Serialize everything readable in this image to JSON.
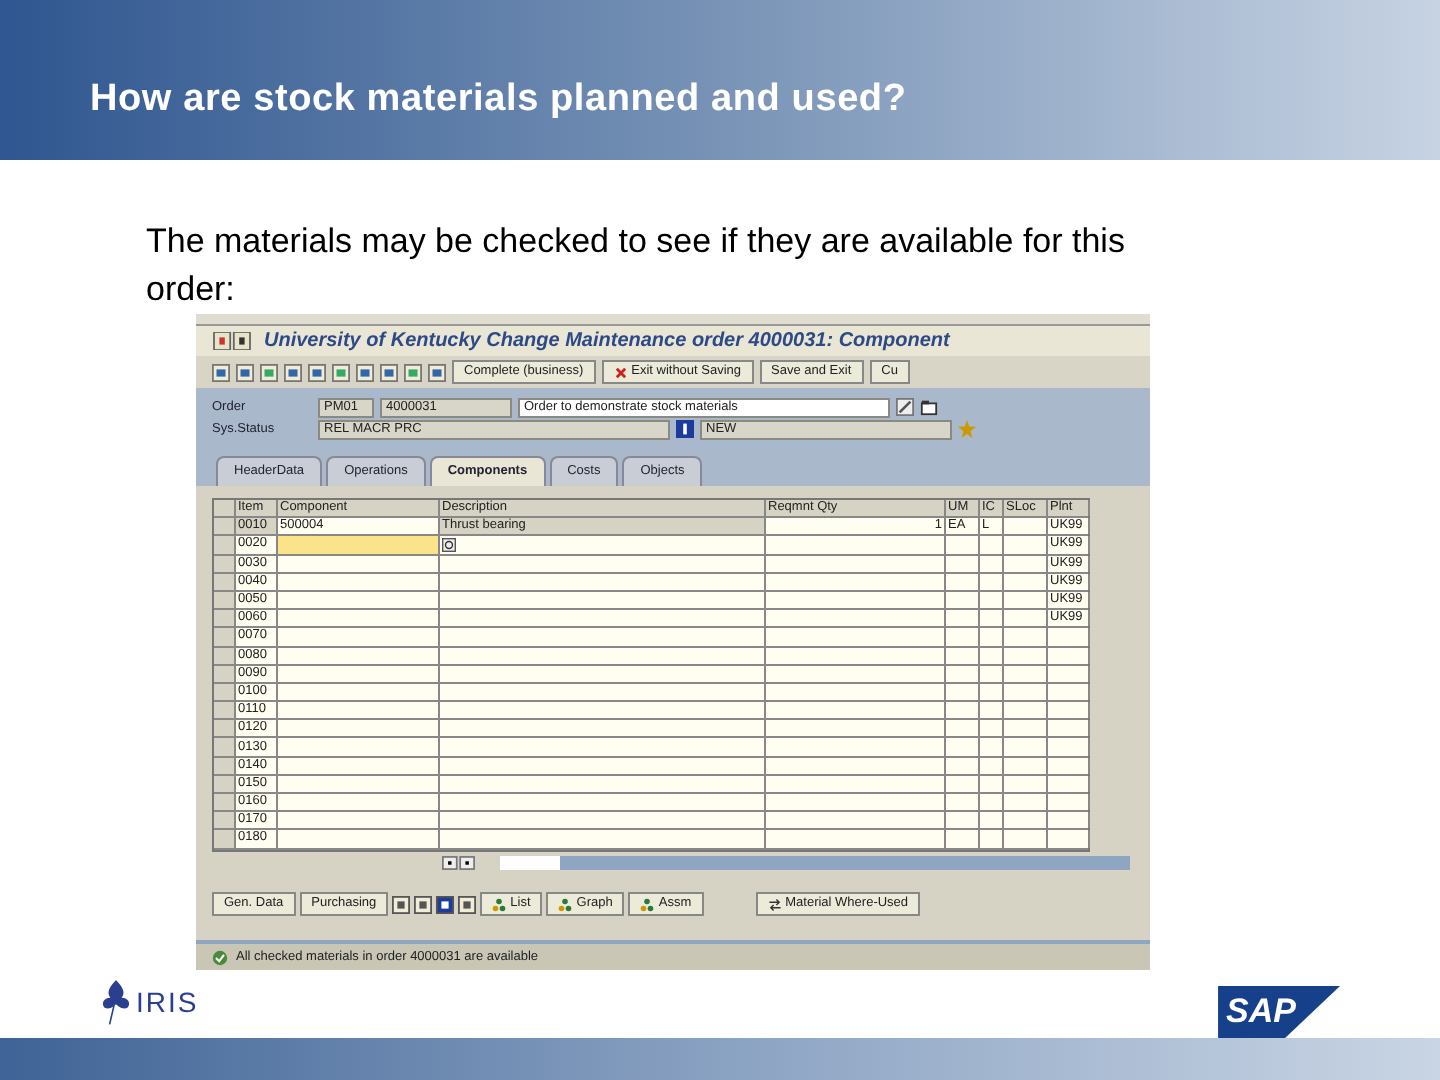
{
  "slide": {
    "title": "How are stock materials planned and used?",
    "body": "The materials may be checked to see if they are available for this order:"
  },
  "sap": {
    "window_title": "University of Kentucky Change Maintenance order 4000031: Component",
    "toolbar_buttons": [
      {
        "label": "Complete (business)",
        "kind": "plain"
      },
      {
        "label": "Exit without Saving",
        "kind": "exit"
      },
      {
        "label": "Save and Exit",
        "kind": "plain"
      },
      {
        "label": "Cu",
        "kind": "plain"
      }
    ],
    "order": {
      "label": "Order",
      "type": "PM01",
      "number": "4000031",
      "description": "Order to demonstrate stock materials"
    },
    "status": {
      "label": "Sys.Status",
      "value": "REL  MACR  PRC",
      "user_status": "NEW"
    },
    "tabs": [
      {
        "label": "HeaderData",
        "selected": false
      },
      {
        "label": "Operations",
        "selected": false
      },
      {
        "label": "Components",
        "selected": true
      },
      {
        "label": "Costs",
        "selected": false
      },
      {
        "label": "Objects",
        "selected": false
      }
    ],
    "columns": [
      "Item",
      "Component",
      "Description",
      "Reqmnt Qty",
      "UM",
      "IC",
      "SLoc",
      "Plnt"
    ],
    "rows": [
      {
        "item": "0010",
        "component": "500004",
        "description": "Thrust bearing",
        "qty": "1",
        "um": "EA",
        "ic": "L",
        "sloc": "",
        "plant": "UK99",
        "focused": false
      },
      {
        "item": "0020",
        "component": "",
        "description": "",
        "qty": "",
        "um": "",
        "ic": "",
        "sloc": "",
        "plant": "UK99",
        "focused": true
      },
      {
        "item": "0030",
        "component": "",
        "description": "",
        "qty": "",
        "um": "",
        "ic": "",
        "sloc": "",
        "plant": "UK99",
        "focused": false
      },
      {
        "item": "0040",
        "component": "",
        "description": "",
        "qty": "",
        "um": "",
        "ic": "",
        "sloc": "",
        "plant": "UK99",
        "focused": false
      },
      {
        "item": "0050",
        "component": "",
        "description": "",
        "qty": "",
        "um": "",
        "ic": "",
        "sloc": "",
        "plant": "UK99",
        "focused": false
      },
      {
        "item": "0060",
        "component": "",
        "description": "",
        "qty": "",
        "um": "",
        "ic": "",
        "sloc": "",
        "plant": "UK99",
        "focused": false
      },
      {
        "item": "0070",
        "component": "",
        "description": "",
        "qty": "",
        "um": "",
        "ic": "",
        "sloc": "",
        "plant": "",
        "focused": false
      },
      {
        "item": "0080",
        "component": "",
        "description": "",
        "qty": "",
        "um": "",
        "ic": "",
        "sloc": "",
        "plant": "",
        "focused": false
      },
      {
        "item": "0090",
        "component": "",
        "description": "",
        "qty": "",
        "um": "",
        "ic": "",
        "sloc": "",
        "plant": "",
        "focused": false
      },
      {
        "item": "0100",
        "component": "",
        "description": "",
        "qty": "",
        "um": "",
        "ic": "",
        "sloc": "",
        "plant": "",
        "focused": false
      },
      {
        "item": "0110",
        "component": "",
        "description": "",
        "qty": "",
        "um": "",
        "ic": "",
        "sloc": "",
        "plant": "",
        "focused": false
      },
      {
        "item": "0120",
        "component": "",
        "description": "",
        "qty": "",
        "um": "",
        "ic": "",
        "sloc": "",
        "plant": "",
        "focused": false
      },
      {
        "item": "0130",
        "component": "",
        "description": "",
        "qty": "",
        "um": "",
        "ic": "",
        "sloc": "",
        "plant": "",
        "focused": false
      },
      {
        "item": "0140",
        "component": "",
        "description": "",
        "qty": "",
        "um": "",
        "ic": "",
        "sloc": "",
        "plant": "",
        "focused": false
      },
      {
        "item": "0150",
        "component": "",
        "description": "",
        "qty": "",
        "um": "",
        "ic": "",
        "sloc": "",
        "plant": "",
        "focused": false
      },
      {
        "item": "0160",
        "component": "",
        "description": "",
        "qty": "",
        "um": "",
        "ic": "",
        "sloc": "",
        "plant": "",
        "focused": false
      },
      {
        "item": "0170",
        "component": "",
        "description": "",
        "qty": "",
        "um": "",
        "ic": "",
        "sloc": "",
        "plant": "",
        "focused": false
      },
      {
        "item": "0180",
        "component": "",
        "description": "",
        "qty": "",
        "um": "",
        "ic": "",
        "sloc": "",
        "plant": "",
        "focused": false
      }
    ],
    "bottom_buttons": [
      {
        "label": "Gen. Data",
        "kind": "plain"
      },
      {
        "label": "Purchasing",
        "kind": "plain"
      },
      {
        "label": "List",
        "kind": "iconic"
      },
      {
        "label": "Graph",
        "kind": "iconic"
      },
      {
        "label": "Assm",
        "kind": "iconic"
      },
      {
        "label": "Material Where-Used",
        "kind": "where"
      }
    ],
    "status_bar": "All checked materials in order 4000031 are available"
  },
  "logos": {
    "iris": "IRIS",
    "sap": "SAP"
  }
}
